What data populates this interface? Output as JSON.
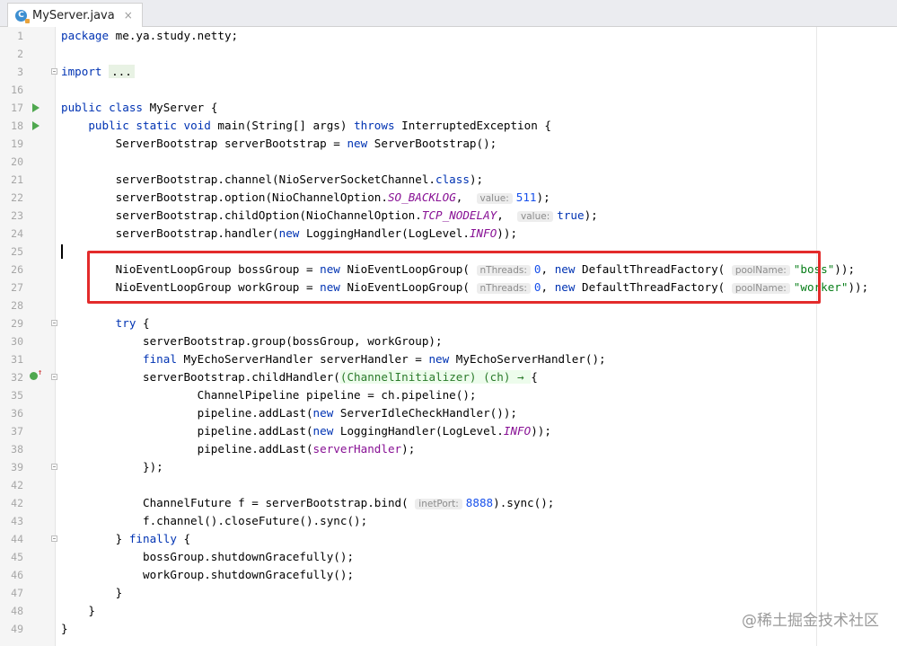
{
  "tab": {
    "filename": "MyServer.java",
    "close": "×",
    "icon": "java-class-icon"
  },
  "watermark": "@稀土掘金技术社区",
  "colors": {
    "keyword": "#0033b3",
    "string": "#067d17",
    "number": "#1750eb",
    "static_field": "#871094",
    "highlight_box": "#e32b2b"
  },
  "lines": [
    {
      "n": "1",
      "html": "<span class='k'>package</span> me.ya.study.netty;"
    },
    {
      "n": "2",
      "html": ""
    },
    {
      "n": "3",
      "html": "<span class='k'>import</span> <span class='fold-text'>...</span>"
    },
    {
      "n": "16",
      "html": ""
    },
    {
      "n": "17",
      "html": "<span class='k'>public class</span> MyServer {"
    },
    {
      "n": "18",
      "html": "    <span class='k'>public static void</span> main(String[] args) <span class='k'>throws</span> InterruptedException {"
    },
    {
      "n": "19",
      "html": "        ServerBootstrap serverBootstrap = <span class='k'>new</span> ServerBootstrap();"
    },
    {
      "n": "20",
      "html": ""
    },
    {
      "n": "21",
      "html": "        serverBootstrap.channel(NioServerSocketChannel.<span class='k'>class</span>);"
    },
    {
      "n": "22",
      "html": "        serverBootstrap.option(NioChannelOption.<span class='st'>SO_BACKLOG</span>,  <span class='hint'>value:</span><span class='n'>511</span>);"
    },
    {
      "n": "23",
      "html": "        serverBootstrap.childOption(NioChannelOption.<span class='st'>TCP_NODELAY</span>,  <span class='hint'>value:</span><span class='k'>true</span>);"
    },
    {
      "n": "24",
      "html": "        serverBootstrap.handler(<span class='k'>new</span> LoggingHandler(LogLevel.<span class='st'>INFO</span>));"
    },
    {
      "n": "25",
      "html": ""
    },
    {
      "n": "26",
      "html": "        NioEventLoopGroup bossGroup = <span class='k'>new</span> NioEventLoopGroup( <span class='hint'>nThreads:</span><span class='n'>0</span>, <span class='k'>new</span> DefaultThreadFactory( <span class='hint'>poolName:</span><span class='s'>\"boss\"</span>));"
    },
    {
      "n": "27",
      "html": "        NioEventLoopGroup workGroup = <span class='k'>new</span> NioEventLoopGroup( <span class='hint'>nThreads:</span><span class='n'>0</span>, <span class='k'>new</span> DefaultThreadFactory( <span class='hint'>poolName:</span><span class='s'>\"worker\"</span>));"
    },
    {
      "n": "28",
      "html": ""
    },
    {
      "n": "29",
      "html": "        <span class='k'>try</span> {"
    },
    {
      "n": "30",
      "html": "            serverBootstrap.group(bossGroup, workGroup);"
    },
    {
      "n": "31",
      "html": "            <span class='k'>final</span> MyEchoServerHandler serverHandler = <span class='k'>new</span> MyEchoServerHandler();"
    },
    {
      "n": "32",
      "html": "            serverBootstrap.childHandler(<span class='lam'>(ChannelInitializer) (ch) → </span>{"
    },
    {
      "n": "35",
      "html": "                    ChannelPipeline pipeline = ch.pipeline();"
    },
    {
      "n": "36",
      "html": "                    pipeline.addLast(<span class='k'>new</span> ServerIdleCheckHandler());"
    },
    {
      "n": "37",
      "html": "                    pipeline.addLast(<span class='k'>new</span> LoggingHandler(LogLevel.<span class='st'>INFO</span>));"
    },
    {
      "n": "38",
      "html": "                    pipeline.addLast(<span class='f'>serverHandler</span>);"
    },
    {
      "n": "39",
      "html": "            });"
    },
    {
      "n": "42",
      "html": ""
    },
    {
      "n": "42",
      "html": "            ChannelFuture f = serverBootstrap.bind( <span class='hint'>inetPort:</span><span class='n'>8888</span>).sync();"
    },
    {
      "n": "43",
      "html": "            f.channel().closeFuture().sync();"
    },
    {
      "n": "44",
      "html": "        } <span class='k'>finally</span> {"
    },
    {
      "n": "45",
      "html": "            bossGroup.shutdownGracefully();"
    },
    {
      "n": "46",
      "html": "            workGroup.shutdownGracefully();"
    },
    {
      "n": "47",
      "html": "        }"
    },
    {
      "n": "48",
      "html": "    }"
    },
    {
      "n": "49",
      "html": "}"
    }
  ]
}
